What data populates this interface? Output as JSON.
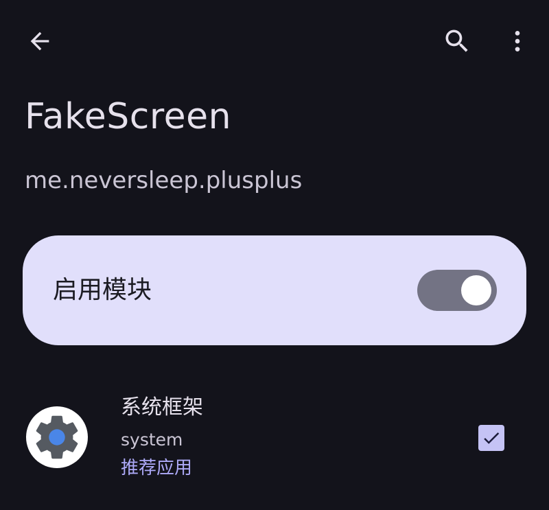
{
  "header": {
    "back_icon": "arrow-back-icon",
    "search_icon": "search-icon",
    "more_icon": "more-vert-icon"
  },
  "module": {
    "name": "FakeScreen",
    "package": "me.neversleep.plusplus"
  },
  "enable_card": {
    "label": "启用模块",
    "enabled": true
  },
  "scope_list": [
    {
      "name": "系统框架",
      "package": "system",
      "tag": "推荐应用",
      "icon": "gear-icon",
      "checked": true
    }
  ],
  "colors": {
    "background": "#13131b",
    "card": "#e1dffb",
    "switch_track": "#737384",
    "accent": "#aeaaf9",
    "checkbox": "#c5c3f5"
  }
}
